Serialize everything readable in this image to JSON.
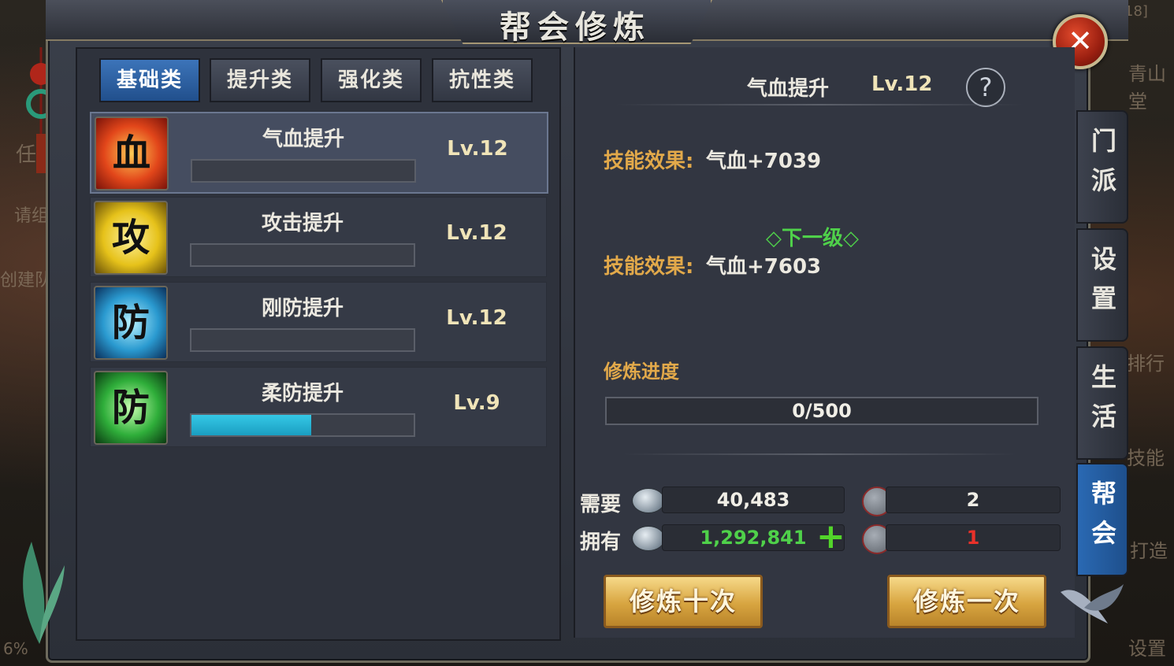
{
  "background": {
    "left_texts": [
      "任",
      "请组",
      "创建队",
      "6%"
    ],
    "right_texts": [
      "[18]",
      "青山堂",
      "排行",
      "技能",
      "打造",
      "设置"
    ]
  },
  "window": {
    "title": "帮会修炼",
    "close_icon": "close-icon"
  },
  "tabs": [
    {
      "label": "基础类",
      "active": true
    },
    {
      "label": "提升类",
      "active": false
    },
    {
      "label": "强化类",
      "active": false
    },
    {
      "label": "抗性类",
      "active": false
    }
  ],
  "skills": [
    {
      "name": "气血提升",
      "level": "Lv.12",
      "icon_char": "血",
      "icon": "blood-icon",
      "progress": 0
    },
    {
      "name": "攻击提升",
      "level": "Lv.12",
      "icon_char": "攻",
      "icon": "attack-icon",
      "progress": 0
    },
    {
      "name": "刚防提升",
      "level": "Lv.12",
      "icon_char": "防",
      "icon": "physical-defense-icon",
      "progress": 0
    },
    {
      "name": "柔防提升",
      "level": "Lv.9",
      "icon_char": "防",
      "icon": "magic-defense-icon",
      "progress": 0.54
    }
  ],
  "detail": {
    "skill_name": "气血提升",
    "skill_level": "Lv.12",
    "help_icon": "?",
    "effect_label": "技能效果:",
    "current_effect": "气血+7039",
    "next_level_label": "◇下一级◇",
    "next_effect_label": "技能效果:",
    "next_effect": "气血+7603",
    "progress_label": "修炼进度",
    "progress_text": "0/500"
  },
  "cost": {
    "need_label": "需要",
    "have_label": "拥有",
    "need_silver": "40,483",
    "have_silver": "1,292,841",
    "need_contribution": "2",
    "have_contribution": "1",
    "add_icon": "+"
  },
  "buttons": {
    "train_ten": "修炼十次",
    "train_once": "修炼一次"
  },
  "side_tabs": [
    {
      "label": "门派",
      "active": false
    },
    {
      "label": "设置",
      "active": false
    },
    {
      "label": "生活",
      "active": false
    },
    {
      "label": "帮会",
      "active": true
    }
  ],
  "colors": {
    "accent_blue": "#2a69b3",
    "gold_label": "#e2a94a",
    "green_next": "#4fd14a",
    "red_insufficient": "#e8312a"
  }
}
